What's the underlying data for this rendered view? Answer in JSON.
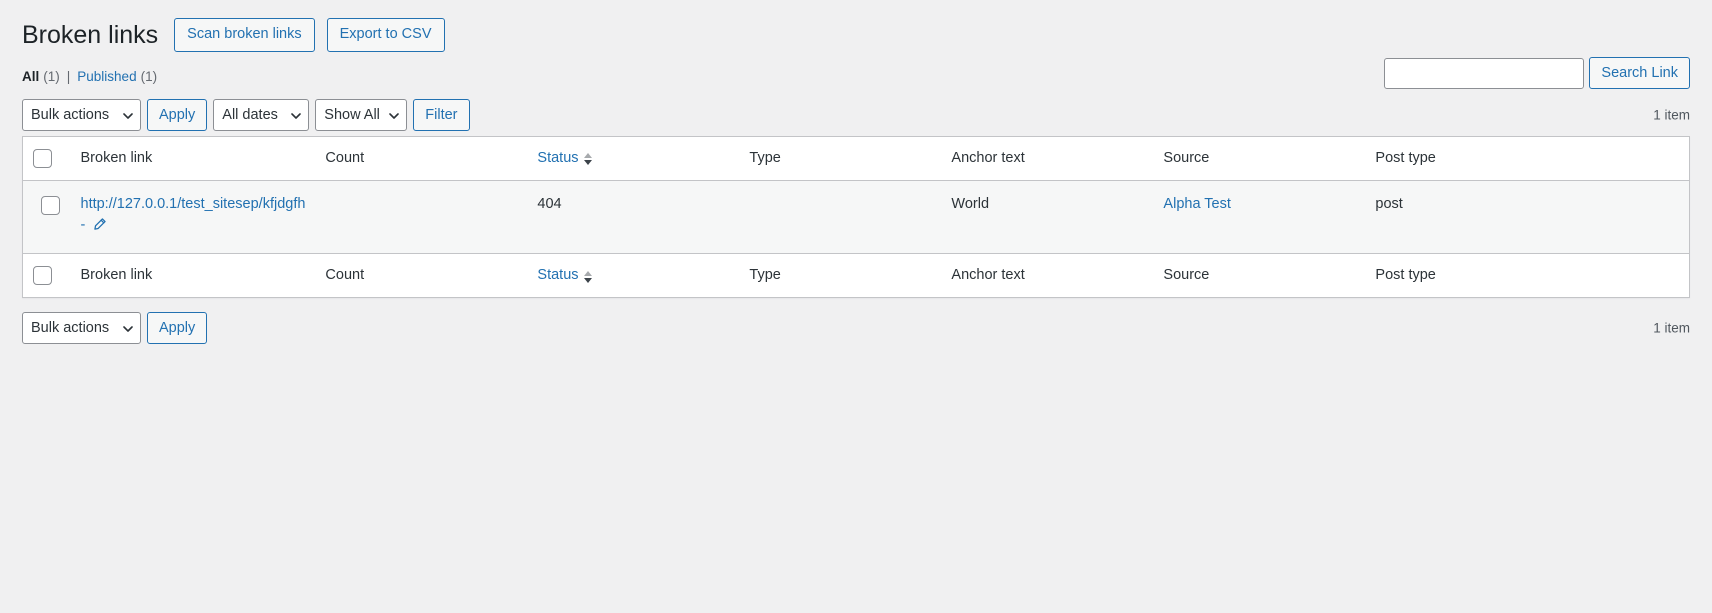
{
  "header": {
    "title": "Broken links",
    "actions": [
      {
        "label": "Scan broken links",
        "name": "scan-broken-links-button"
      },
      {
        "label": "Export to CSV",
        "name": "export-to-csv-button"
      }
    ]
  },
  "views": {
    "all": {
      "label": "All",
      "count": "(1)"
    },
    "separator": "|",
    "published": {
      "label": "Published",
      "count": "(1)"
    }
  },
  "search": {
    "value": "",
    "placeholder": "",
    "submit_label": "Search Link"
  },
  "tablenav_top": {
    "bulk_actions": {
      "selected": "Bulk actions",
      "options": [
        "Bulk actions"
      ]
    },
    "apply_label": "Apply",
    "dates": {
      "selected": "All dates",
      "options": [
        "All dates"
      ]
    },
    "show_all": {
      "selected": "Show All",
      "options": [
        "Show All"
      ]
    },
    "filter_label": "Filter",
    "item_count": "1 item"
  },
  "tablenav_bottom": {
    "bulk_actions": {
      "selected": "Bulk actions",
      "options": [
        "Bulk actions"
      ]
    },
    "apply_label": "Apply",
    "item_count": "1 item"
  },
  "table": {
    "columns": [
      {
        "key": "cb",
        "label": ""
      },
      {
        "key": "link",
        "label": "Broken link",
        "sortable": false
      },
      {
        "key": "count",
        "label": "Count",
        "sortable": false
      },
      {
        "key": "status",
        "label": "Status",
        "sortable": true
      },
      {
        "key": "type",
        "label": "Type",
        "sortable": false
      },
      {
        "key": "anchor",
        "label": "Anchor text",
        "sortable": false
      },
      {
        "key": "source",
        "label": "Source",
        "sortable": false
      },
      {
        "key": "posttype",
        "label": "Post type",
        "sortable": false
      }
    ],
    "rows": [
      {
        "link_line1": "http://127.0.0.1/test_sitesep/",
        "link_line2": "kfjdgfh",
        "link_suffix": "-",
        "edit_icon": "pencil-icon",
        "count": "",
        "status": "404",
        "type": "",
        "anchor": "World",
        "source": "Alpha Test",
        "posttype": "post"
      }
    ]
  },
  "colors": {
    "accent": "#2271b1",
    "page_bg": "#f0f0f1",
    "row_bg": "#f6f7f7",
    "text": "#2c3338",
    "border": "#c3c4c7"
  }
}
